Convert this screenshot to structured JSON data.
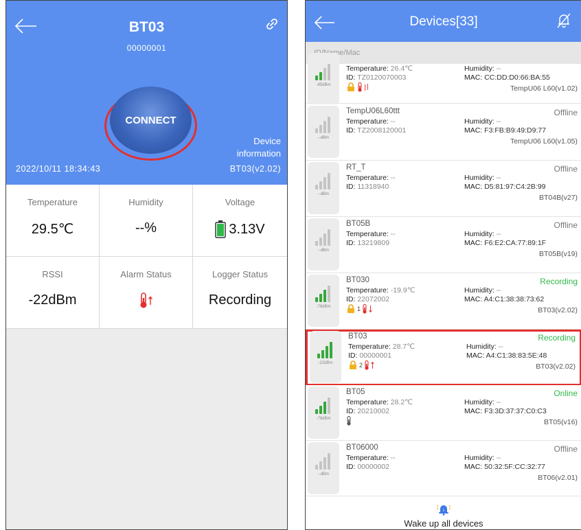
{
  "left": {
    "title": "BT03",
    "subtitle": "00000001",
    "connect_label": "CONNECT",
    "device_info_line1": "Device",
    "device_info_line2": "information",
    "datetime": "2022/10/11  18:34:43",
    "model": "BT03(v2.02)",
    "cells": {
      "temperature": {
        "label": "Temperature",
        "value": "29.5℃"
      },
      "humidity": {
        "label": "Humidity",
        "value": "--%"
      },
      "voltage": {
        "label": "Voltage",
        "value": "3.13V"
      },
      "rssi": {
        "label": "RSSI",
        "value": "-22dBm"
      },
      "alarm": {
        "label": "Alarm Status"
      },
      "logger": {
        "label": "Logger Status",
        "value": "Recording"
      }
    },
    "colors": {
      "header": "#5b8fef",
      "accent_red": "#e2302f",
      "battery": "#2fb84a"
    }
  },
  "right": {
    "title": "Devices[33]",
    "search_placeholder": "ID/Name/Mac",
    "wake_label": "Wake up all devices",
    "temp_label": "Temperature",
    "hum_label": "Humidity",
    "id_label": "ID",
    "mac_label": "MAC",
    "items": [
      {
        "name": "",
        "temp": "26.4℃",
        "id": "TZ0120070003",
        "humidity": "--",
        "mac": "CC:DD:D0:66:BA:55",
        "status": "",
        "model": "TempU06 L60(v1.02)",
        "dbm": "-85dBm",
        "bars": 2,
        "icons": "lock-alarm"
      },
      {
        "name": "TempU06L60ttt",
        "temp": "--",
        "id": "TZ2008120001",
        "humidity": "--",
        "mac": "F3:FB:B9:49:D9:77",
        "status": "Offline",
        "model": "TempU06 L60(v1.05)",
        "dbm": "--dBm",
        "bars": 0,
        "icons": ""
      },
      {
        "name": "RT_T",
        "temp": "--",
        "id": "11318940",
        "humidity": "--",
        "mac": "D5:81:97:C4:2B:99",
        "status": "Offline",
        "model": "BT04B(v27)",
        "dbm": "--dBm",
        "bars": 0,
        "icons": ""
      },
      {
        "name": "BT05B",
        "temp": "--",
        "id": "13219809",
        "humidity": "--",
        "mac": "F6:E2:CA:77:89:1F",
        "status": "Offline",
        "model": "BT05B(v19)",
        "dbm": "--dBm",
        "bars": 0,
        "icons": ""
      },
      {
        "name": "BT030",
        "temp": "-19.9℃",
        "id": "22072002",
        "humidity": "--",
        "mac": "A4:C1:38:38:73:62",
        "status": "Recording",
        "model": "BT03(v2.02)",
        "dbm": "-78dBm",
        "bars": 3,
        "icons": "lock1-alarm-down"
      },
      {
        "name": "BT03",
        "temp": "28.7℃",
        "id": "00000001",
        "humidity": "--",
        "mac": "A4:C1:38:83:5E:48",
        "status": "Recording",
        "model": "BT03(v2.02)",
        "dbm": "-22dBm",
        "bars": 4,
        "icons": "lock2-alarm-up"
      },
      {
        "name": "BT05",
        "temp": "28.2℃",
        "id": "20210002",
        "humidity": "--",
        "mac": "F3:3D:37:37:C0:C3",
        "status": "Online",
        "model": "BT05(v16)",
        "dbm": "-76dBm",
        "bars": 3,
        "icons": "therm"
      },
      {
        "name": "BT06000",
        "temp": "--",
        "id": "00000002",
        "humidity": "--",
        "mac": "50:32:5F:CC:32:77",
        "status": "Offline",
        "model": "BT06(v2.01)",
        "dbm": "--dBm",
        "bars": 0,
        "icons": ""
      }
    ],
    "lock_numbers": [
      "1",
      "2"
    ],
    "colors": {
      "recording": "#2fb84a",
      "online": "#2fb84a",
      "offline": "#777777",
      "bar_on": "#36a83c",
      "bar_off": "#c4c4c4"
    }
  }
}
